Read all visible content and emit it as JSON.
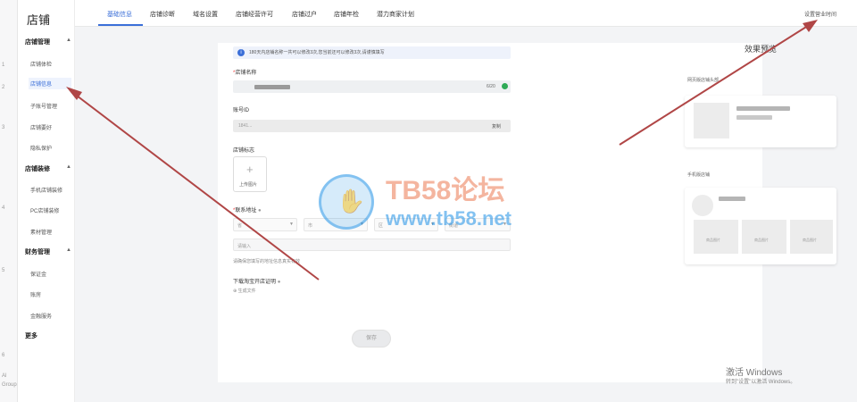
{
  "sidebar": {
    "title": "店铺",
    "groups": [
      {
        "label": "店铺管理",
        "items": [
          "店铺体检",
          "店铺信息",
          "子账号管理",
          "店铺要好",
          "隐私保护"
        ]
      },
      {
        "label": "店铺装修",
        "items": [
          "手机店铺装修",
          "PC店铺装修",
          "素材管理"
        ]
      },
      {
        "label": "财务管理",
        "items": [
          "保证金",
          "账房",
          "金融服务"
        ]
      },
      {
        "label": "更多",
        "items": []
      }
    ],
    "active_item": "店铺信息"
  },
  "left_ticks": [
    "1",
    "2",
    "3",
    "4",
    "5",
    "6",
    "Al",
    "Group"
  ],
  "topnav": {
    "tabs": [
      "基础信息",
      "店铺诊断",
      "域名设置",
      "店铺经营许可",
      "店铺过户",
      "店铺年检",
      "潜力商家计划"
    ],
    "active_index": 0,
    "right_link": "设置营业时间"
  },
  "form": {
    "notice": "180天内店铺名称一共可以修改3次,您当前还可以修改3次,请谨慎填写",
    "shop_name": {
      "label": "店铺名称",
      "counter": "6/20"
    },
    "account": {
      "label": "账号ID",
      "value": "1841...",
      "copy": "复制"
    },
    "logo": {
      "label": "店铺标志",
      "upload_label": "上传图片"
    },
    "address": {
      "label": "联系地址",
      "selects": [
        "省",
        "市",
        "区",
        "街道"
      ],
      "detail_placeholder": "请输入",
      "hint": "请确保您填写的地址信息真实有效"
    },
    "permit": {
      "label": "下载淘宝开店证明",
      "link": "生成文件"
    },
    "save_label": "保存"
  },
  "preview": {
    "title": "效果预览",
    "section1": "网页版店铺头部",
    "section2": "手机版店铺",
    "thumb_label": "商品图片"
  },
  "watermark": {
    "line1": "TB58论坛",
    "line2": "www.tb58.net"
  },
  "windows": {
    "line1": "激活 Windows",
    "line2": "转到\"设置\"以激活 Windows。"
  }
}
